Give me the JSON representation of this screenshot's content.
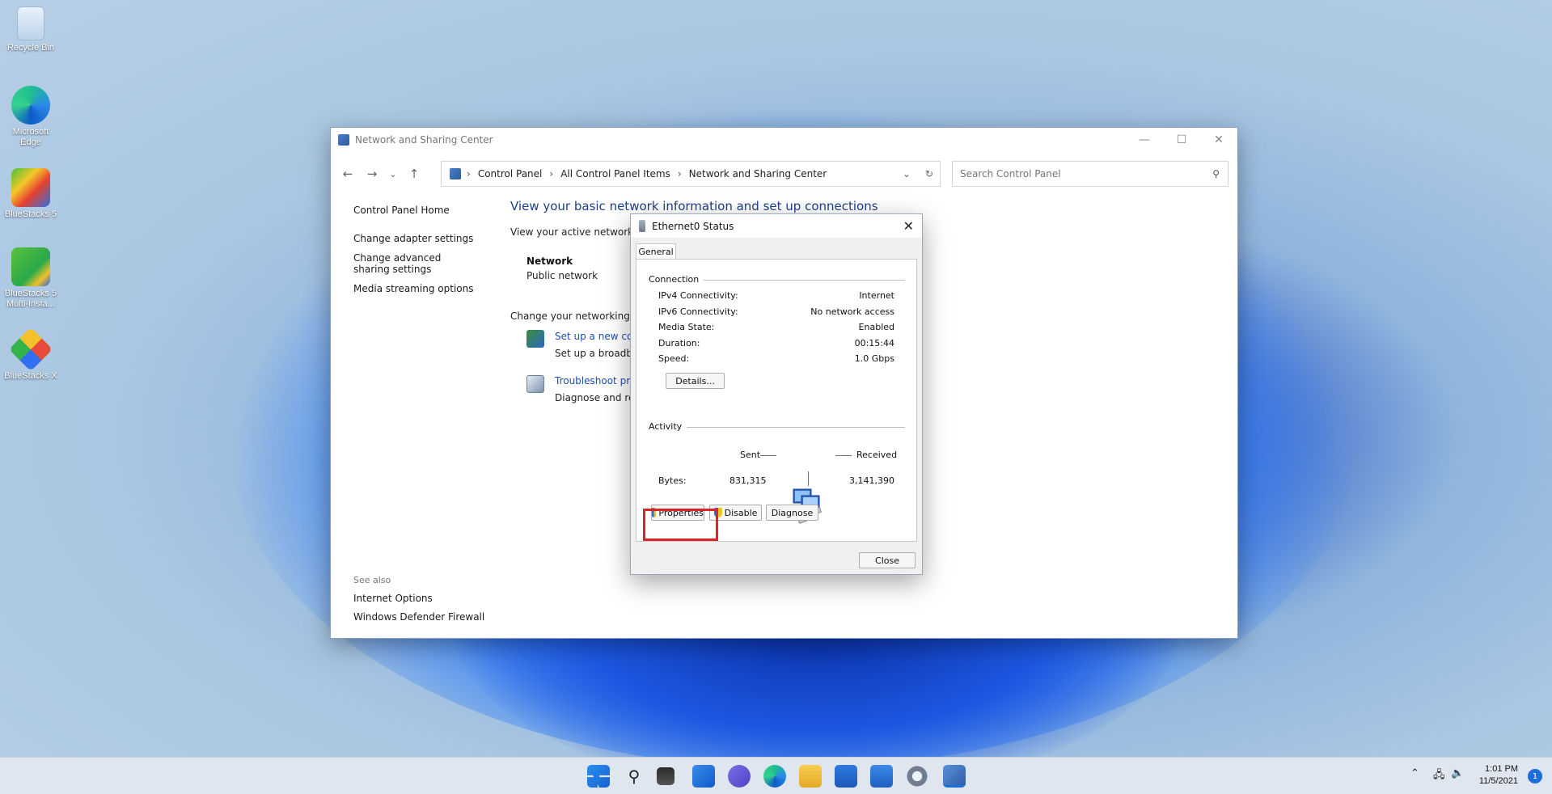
{
  "desktop": {
    "icons": [
      {
        "label": "Recycle Bin",
        "icon": "recycle-bin-icon"
      },
      {
        "label": "Microsoft Edge",
        "icon": "edge-icon"
      },
      {
        "label": "BlueStacks 5",
        "icon": "bluestacks-icon"
      },
      {
        "label": "BlueStacks 5 Multi-Insta...",
        "icon": "bluestacks-multi-icon"
      },
      {
        "label": "BlueStacks X",
        "icon": "bluestacks-x-icon"
      }
    ]
  },
  "window": {
    "title": "Network and Sharing Center",
    "controls": {
      "minimize": "—",
      "maximize": "☐",
      "close": "✕"
    },
    "nav": {
      "back": "←",
      "forward": "→",
      "recent": "⌄",
      "up": "↑"
    },
    "breadcrumb": [
      "Control Panel",
      "All Control Panel Items",
      "Network and Sharing Center"
    ],
    "breadcrumb_sep": "›",
    "search_placeholder": "Search Control Panel",
    "left_pane": {
      "home": "Control Panel Home",
      "links": [
        "Change adapter settings",
        "Change advanced sharing settings",
        "Media streaming options"
      ]
    },
    "see_also": {
      "heading": "See also",
      "links": [
        "Internet Options",
        "Windows Defender Firewall"
      ]
    },
    "main": {
      "title": "View your basic network information and set up connections",
      "active_networks_heading": "View your active networks",
      "network_name": "Network",
      "network_type": "Public network",
      "change_heading": "Change your networking set",
      "tasks": [
        {
          "link": "Set up a new conn",
          "desc": "Set up a broadban"
        },
        {
          "link": "Troubleshoot prob",
          "desc": "Diagnose and rep"
        }
      ]
    }
  },
  "dialog": {
    "title": "Ethernet0 Status",
    "tab": "General",
    "connection_label": "Connection",
    "rows": [
      {
        "key": "IPv4 Connectivity:",
        "value": "Internet"
      },
      {
        "key": "IPv6 Connectivity:",
        "value": "No network access"
      },
      {
        "key": "Media State:",
        "value": "Enabled"
      },
      {
        "key": "Duration:",
        "value": "00:15:44"
      },
      {
        "key": "Speed:",
        "value": "1.0 Gbps"
      }
    ],
    "details_button": "Details...",
    "activity_label": "Activity",
    "sent_label": "Sent",
    "received_label": "Received",
    "bytes_label": "Bytes:",
    "bytes_sent": "831,315",
    "bytes_received": "3,141,390",
    "buttons": {
      "properties": "Properties",
      "disable": "Disable",
      "diagnose": "Diagnose",
      "close": "Close"
    }
  },
  "taskbar": {
    "apps": [
      "start-icon",
      "search-icon",
      "task-view-icon",
      "widgets-icon",
      "chat-icon",
      "edge-icon",
      "file-explorer-icon",
      "store-icon",
      "mail-icon",
      "settings-icon",
      "control-panel-icon"
    ],
    "time": "1:01 PM",
    "date": "11/5/2021",
    "notification_count": "1"
  }
}
